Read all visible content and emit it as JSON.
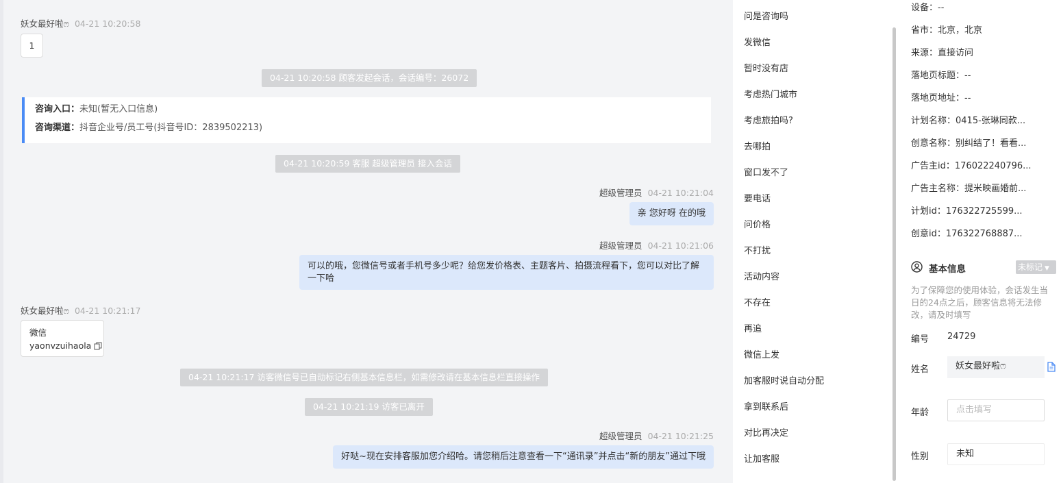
{
  "chat": {
    "m1": {
      "sender": "妖女最好啦ෆ",
      "time": "04-21 10:20:58",
      "text": "1"
    },
    "sys1": "04-21 10:20:58 顾客发起会话，会话编号：26072",
    "card": {
      "entry_label": "咨询入口：",
      "entry_value": "未知(暂无入口信息)",
      "channel_label": "咨询渠道：",
      "channel_value": "抖音企业号/员工号(抖音号ID：2839502213)"
    },
    "sys2": "04-21 10:20:59 客服 超级管理员 接入会话",
    "m2": {
      "sender": "超级管理员",
      "time": "04-21 10:21:04",
      "text": "亲 您好呀 在的哦"
    },
    "m3": {
      "sender": "超级管理员",
      "time": "04-21 10:21:06",
      "text": "可以的哦，您微信号或者手机号多少呢？给您发价格表、主题客片、拍摄流程看下，您可以对比了解一下哈"
    },
    "m4": {
      "sender": "妖女最好啦ෆ",
      "time": "04-21 10:21:17",
      "label": "微信",
      "value": "yaonvzuihaola"
    },
    "sys3": "04-21 10:21:17 访客微信号已自动标记右侧基本信息栏，如需修改请在基本信息栏直接操作",
    "sys4": "04-21 10:21:19 访客已离开",
    "m5": {
      "sender": "超级管理员",
      "time": "04-21 10:21:25",
      "text": "好哒~现在安排客服加您介绍哈。请您稍后注意查看一下“通讯录”并点击“新的朋友”通过下哦"
    }
  },
  "phrases": [
    "问是咨询吗",
    "发微信",
    "暂时没有店",
    "考虑热门城市",
    "考虑旅拍吗?",
    "去哪拍",
    "窗口发不了",
    "要电话",
    "问价格",
    "不打扰",
    "活动内容",
    "不存在",
    "再追",
    "微信上发",
    "加客服时说自动分配",
    "拿到联系后",
    "对比再决定",
    "让加客服"
  ],
  "source": [
    {
      "label": "设备：",
      "value": "--"
    },
    {
      "label": "省市：",
      "value": "北京，北京"
    },
    {
      "label": "来源：",
      "value": "直接访问"
    },
    {
      "label": "落地页标题：",
      "value": "--"
    },
    {
      "label": "落地页地址：",
      "value": "--"
    },
    {
      "label": "计划名称：",
      "value": "0415-张琳同款..."
    },
    {
      "label": "创意名称：",
      "value": "别纠结了！看看..."
    },
    {
      "label": "广告主id：",
      "value": "176022240796..."
    },
    {
      "label": "广告主名称：",
      "value": "提米映画婚前..."
    },
    {
      "label": "计划id：",
      "value": "176322725599..."
    },
    {
      "label": "创意id：",
      "value": "176322768887..."
    }
  ],
  "basic": {
    "title": "基本信息",
    "tag": "未标记",
    "notice": "为了保障您的使用体验，会话发生当日的24点之后，顾客信息将无法修改，请及时填写",
    "id_label": "编号",
    "id_value": "24729",
    "name_label": "姓名",
    "name_value": "妖女最好啦ෆ",
    "age_label": "年龄",
    "age_placeholder": "点击填写",
    "gender_label": "性别",
    "gender_value": "未知"
  },
  "colors": {
    "accent": "#4a8bf5",
    "bubble_right": "#dce8fb",
    "system_bg": "#d4d5d7",
    "chat_bg": "#f3f4f6"
  }
}
